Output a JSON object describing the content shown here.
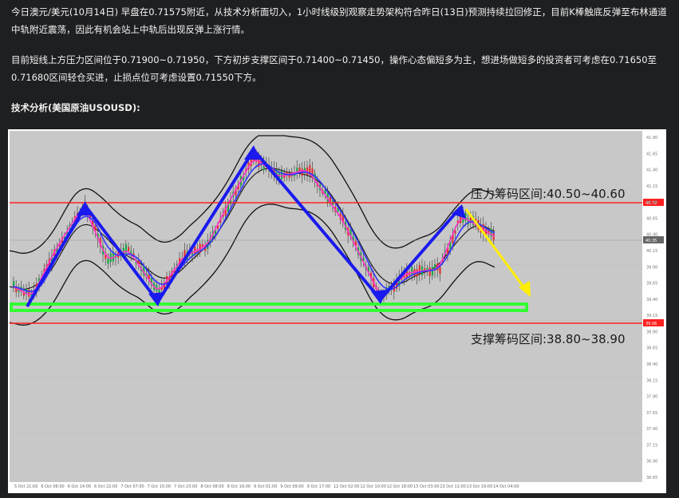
{
  "article": {
    "paragraph1": "今日澳元/美元(10月14日) 早盘在0.71575附近，从技术分析面切入，1小时线级别观察走势架构符合昨日(13日)预测持续拉回修正，目前K棒触底反弹至布林通道中轨附近震荡，因此有机会站上中轨后出现反弹上涨行情。",
    "paragraph2": "目前短线上方压力区间位于0.71900~0.71950，下方初步支撑区间于0.71400~0.71450，操作心态偏短多为主，想进场做短多的投资者可考虑在0.71650至0.71680区间轻仓买进，止损点位可考虑设置0.71550下方。",
    "section_title": "技术分析(美国原油USOUSD):"
  },
  "chart": {
    "resistance_label": "压力筹码区间:40.50~40.60",
    "support_label": "支撑筹码区间:38.80~38.90",
    "y_ticks": [
      "41.90",
      "41.65",
      "41.40",
      "41.15",
      "40.90",
      "40.65",
      "40.40",
      "40.15",
      "39.90",
      "39.65",
      "39.40",
      "39.15",
      "38.90",
      "38.65",
      "38.40",
      "38.15",
      "37.90",
      "37.65",
      "37.40",
      "37.15",
      "36.90",
      "36.65"
    ],
    "x_ticks": [
      "5 Oct 21:00",
      "6 Oct 06:00",
      "6 Oct 14:00",
      "6 Oct 22:00",
      "7 Oct 07:00",
      "7 Oct 15:00",
      "7 Oct 23:00",
      "8 Oct 08:00",
      "8 Oct 16:00",
      "9 Oct 01:00",
      "9 Oct 09:00",
      "9 Oct 17:00",
      "12 Oct 02:00",
      "12 Oct 10:00",
      "12 Oct 18:00",
      "13 Oct 03:00",
      "13 Oct 11:00",
      "13 Oct 19:00",
      "14 Oct 04:00"
    ],
    "price_tag_current": "40.35",
    "price_tag_red_top": "40.72",
    "price_tag_red_bottom": "39.06",
    "colors": {
      "background": "#c8c8c8",
      "resistance_line": "#ff2020",
      "support_band": "#33ff33",
      "arrow_blue": "#1a1aee",
      "arrow_yellow": "#ffee00",
      "ma_pink": "#ff33cc",
      "ma_blue": "#3333ff",
      "bollinger": "#111111"
    }
  }
}
